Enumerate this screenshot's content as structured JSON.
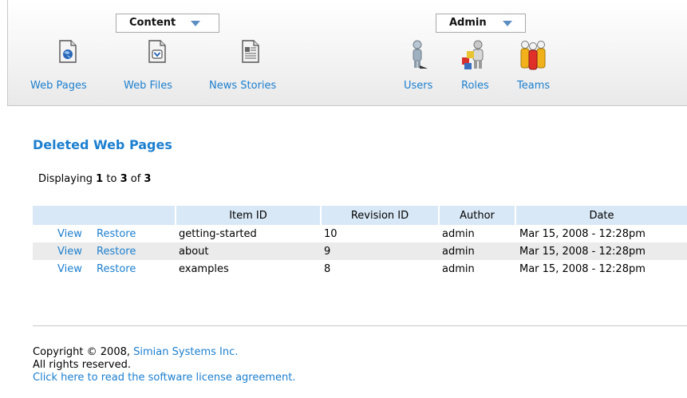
{
  "toolbar": {
    "content_menu": "Content",
    "admin_menu": "Admin",
    "items": [
      {
        "label": "Web Pages",
        "icon": "web-page-icon"
      },
      {
        "label": "Web Files",
        "icon": "web-file-icon"
      },
      {
        "label": "News Stories",
        "icon": "news-story-icon"
      },
      {
        "label": "Users",
        "icon": "user-icon"
      },
      {
        "label": "Roles",
        "icon": "role-icon"
      },
      {
        "label": "Teams",
        "icon": "team-icon"
      }
    ]
  },
  "main": {
    "title": "Deleted Web Pages",
    "displaying": {
      "prefix": "Displaying",
      "start": "1",
      "to": "to",
      "end": "3",
      "of": "of",
      "total": "3"
    },
    "table": {
      "columns": [
        "",
        "Item ID",
        "Revision ID",
        "Author",
        "Date"
      ],
      "view_label": "View",
      "restore_label": "Restore",
      "rows": [
        {
          "item_id": "getting-started",
          "revision_id": "10",
          "author": "admin",
          "date": "Mar 15, 2008 - 12:28pm"
        },
        {
          "item_id": "about",
          "revision_id": "9",
          "author": "admin",
          "date": "Mar 15, 2008 - 12:28pm"
        },
        {
          "item_id": "examples",
          "revision_id": "8",
          "author": "admin",
          "date": "Mar 15, 2008 - 12:28pm"
        }
      ]
    }
  },
  "footer": {
    "copyright_prefix": "Copyright © 2008,",
    "company": "Simian Systems Inc.",
    "rights": "All rights reserved.",
    "license_link": "Click here to read the software license agreement."
  },
  "colors": {
    "link": "#1c7fcf",
    "header_row": "#d9e8f6",
    "alt_row": "#ebebeb"
  }
}
